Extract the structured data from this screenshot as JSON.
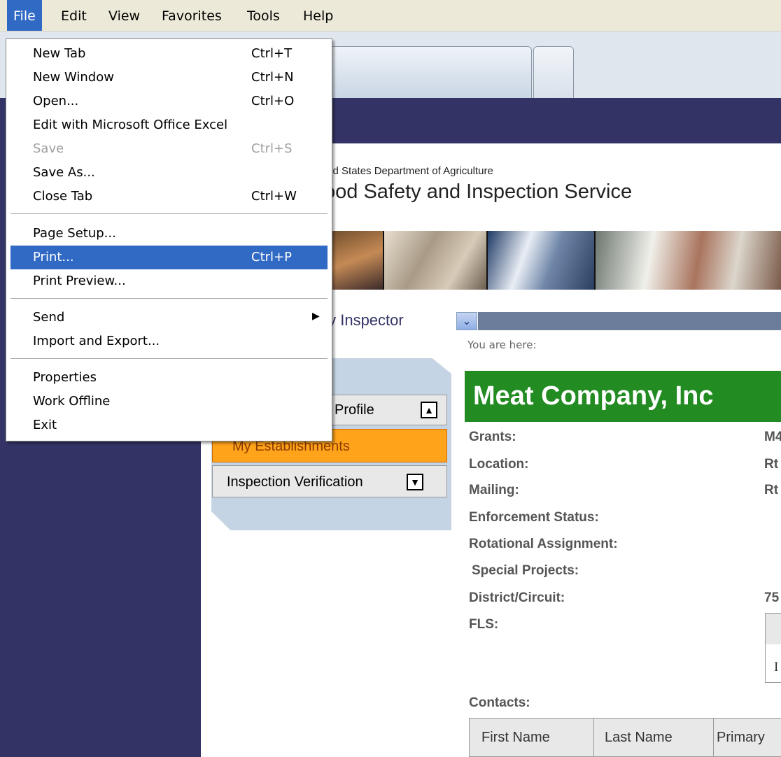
{
  "menubar": {
    "items": [
      "File",
      "Edit",
      "View",
      "Favorites",
      "Tools",
      "Help"
    ]
  },
  "file_menu": {
    "items": [
      {
        "label": "New Tab",
        "shortcut": "Ctrl+T"
      },
      {
        "label": "New Window",
        "shortcut": "Ctrl+N"
      },
      {
        "label": "Open...",
        "shortcut": "Ctrl+O"
      },
      {
        "label": "Edit with Microsoft Office Excel",
        "shortcut": ""
      },
      {
        "label": "Save",
        "shortcut": "Ctrl+S",
        "disabled": true
      },
      {
        "label": "Save As...",
        "shortcut": ""
      },
      {
        "label": "Close Tab",
        "shortcut": "Ctrl+W"
      },
      {
        "label": "Page Setup...",
        "shortcut": ""
      },
      {
        "label": "Print...",
        "shortcut": "Ctrl+P",
        "highlighted": true
      },
      {
        "label": "Print Preview...",
        "shortcut": ""
      },
      {
        "label": "Send",
        "shortcut": "",
        "submenu": true
      },
      {
        "label": "Import and Export...",
        "shortcut": ""
      },
      {
        "label": "Properties",
        "shortcut": ""
      },
      {
        "label": "Work Offline",
        "shortcut": ""
      },
      {
        "label": "Exit",
        "shortcut": ""
      }
    ]
  },
  "header": {
    "agency_line": "ted States Department of Agriculture",
    "service_line": "ood Safety and Inspection Service"
  },
  "role_bar": {
    "role_text": "ty Inspector",
    "dropdown_icon": "chevron-down-icon"
  },
  "breadcrumb": "You are here:",
  "left_panel": {
    "profile_label": "Profile",
    "establishments_label": "My Establishments",
    "inspection_label": "Inspection Verification"
  },
  "establishment": {
    "title": "Meat Company, Inc",
    "fields": [
      {
        "label": "Grants:",
        "value": "M4"
      },
      {
        "label": "Location:",
        "value": "Rt"
      },
      {
        "label": "Mailing:",
        "value": "Rt"
      },
      {
        "label": "Enforcement Status:",
        "value": ""
      },
      {
        "label": "Rotational Assignment:",
        "value": ""
      },
      {
        "label": "Special Projects:",
        "value": ""
      },
      {
        "label": "District/Circuit:",
        "value": "75"
      },
      {
        "label": "FLS:",
        "value": ""
      }
    ],
    "fls_cell": "I",
    "contacts_label": "Contacts:",
    "contacts_columns": [
      "First Name",
      "Last Name",
      "Primary"
    ]
  },
  "colors": {
    "navy": "#333366",
    "menu_highlight": "#316ac5",
    "title_green": "#228b22",
    "orange": "#ffa31a"
  }
}
